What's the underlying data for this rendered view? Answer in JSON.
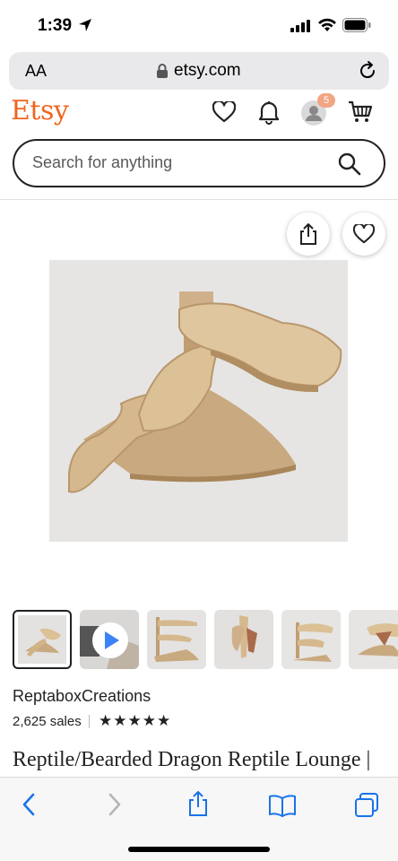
{
  "status_bar": {
    "time": "1:39"
  },
  "browser": {
    "text_size_label": "AA",
    "url": "etsy.com"
  },
  "header": {
    "logo": "Etsy",
    "notification_count": "5",
    "accent_color": "#f1641e"
  },
  "search": {
    "placeholder": "Search for anything"
  },
  "product": {
    "shop_name": "ReptaboxCreations",
    "sales": "2,625 sales",
    "rating_stars": "★★★★★",
    "title": "Reptile/Bearded Dragon Reptile Lounge |"
  },
  "icons": {
    "header": [
      "heart-icon",
      "bell-icon",
      "avatar-icon",
      "cart-icon"
    ],
    "image_actions": [
      "share-icon",
      "favorite-heart-icon"
    ],
    "toolbar": [
      "back-icon",
      "forward-icon",
      "share-icon",
      "bookmarks-icon",
      "tabs-icon"
    ]
  }
}
